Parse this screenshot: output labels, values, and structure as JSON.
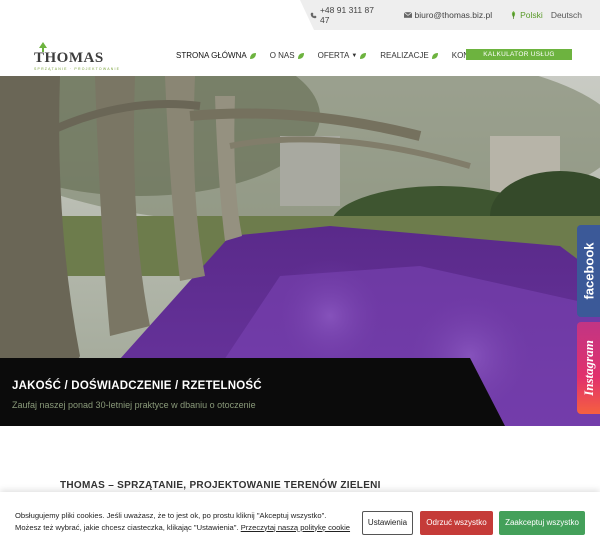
{
  "topbar": {
    "phone": "+48 91 311 87 47",
    "email": "biuro@thomas.biz.pl",
    "lang_active": "Polski",
    "lang_other": "Deutsch"
  },
  "logo": {
    "name": "THOMAS",
    "tagline": "SPRZĄTANIE · PROJEKTOWANIE"
  },
  "nav": {
    "items": [
      {
        "label": "STRONA GŁÓWNA"
      },
      {
        "label": "O NAS"
      },
      {
        "label": "OFERTA"
      },
      {
        "label": "REALIZACJE"
      },
      {
        "label": "KONTAKT"
      }
    ],
    "calc_button": "KALKULATOR USŁUG"
  },
  "hero": {
    "title": "JAKOŚĆ / DOŚWIADCZENIE / RZETELNOŚĆ",
    "subtitle": "Zaufaj naszej ponad 30-letniej praktyce w dbaniu o otoczenie"
  },
  "social": {
    "facebook": "facebook",
    "instagram": "Instagram"
  },
  "section": {
    "heading": "THOMAS – SPRZĄTANIE, PROJEKTOWANIE TERENÓW ZIELENI"
  },
  "cookie": {
    "text_line1": "Obsługujemy pliki cookies. Jeśli uważasz, że to jest ok, po prostu kliknij \"Akceptuj wszystko\".",
    "text_line2": "Możesz też wybrać, jakie chcesz ciasteczka, klikając \"Ustawienia\".",
    "policy_link": "Przeczytaj naszą politykę cookie",
    "settings_button": "Ustawienia",
    "reject_button": "Odrzuć wszystko",
    "accept_button": "Zaakceptuj wszystko"
  },
  "colors": {
    "accent_green": "#6db33f",
    "reject_red": "#c53b38",
    "accept_green": "#44a05a",
    "facebook_blue": "#3b5998"
  },
  "icons": [
    "phone-icon",
    "mail-icon",
    "leaf-icon",
    "tree-icon",
    "chevron-down-icon"
  ]
}
